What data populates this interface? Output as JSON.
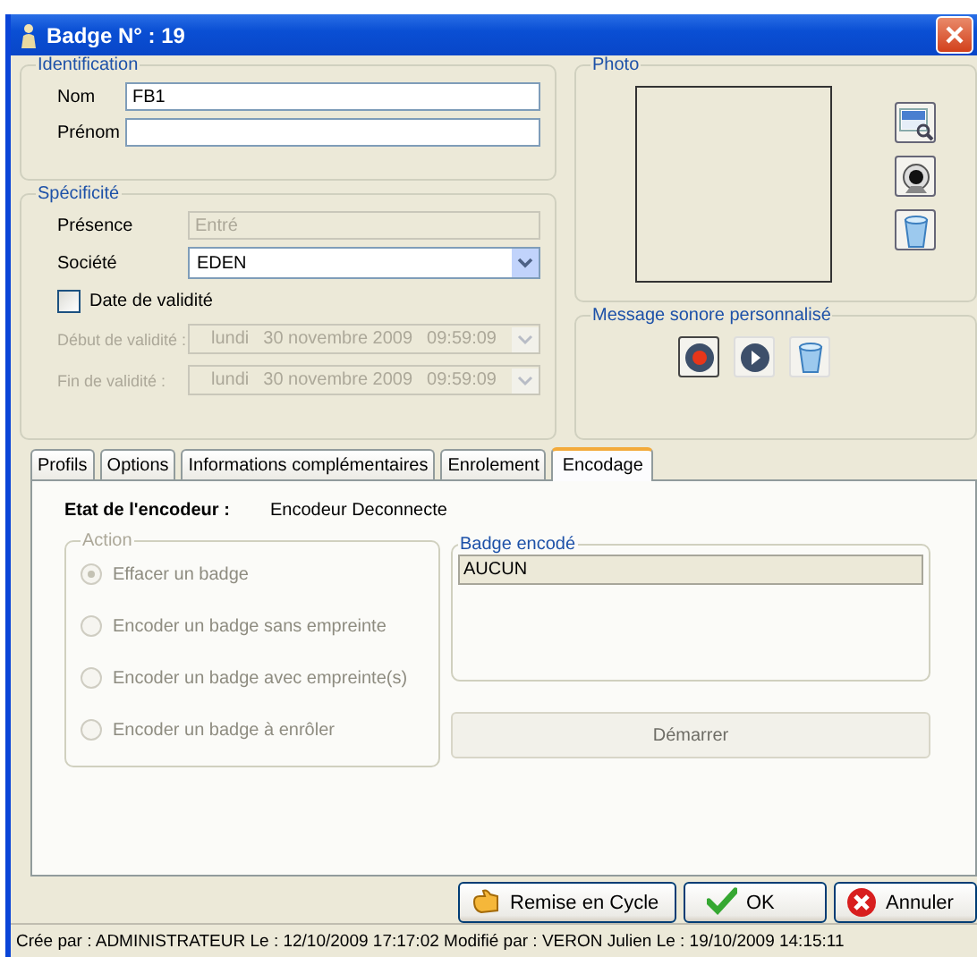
{
  "window": {
    "title": "Badge N° : 19"
  },
  "identification": {
    "title": "Identification",
    "fields": [
      {
        "label": "Nom",
        "value": "FB1"
      },
      {
        "label": "Prénom"
      }
    ]
  },
  "specificite": {
    "title": "Spécificité",
    "presence": {
      "label": "Présence",
      "value": "Entré",
      "disabled": true
    },
    "societe": {
      "label": "Société",
      "value": "EDEN",
      "disabled": false
    },
    "validity_checkbox": {
      "label": "Date de validité",
      "checked": false
    },
    "dates": [
      {
        "label": "Début de validité :",
        "day": "lundi",
        "date": "30 novembre 2009",
        "time": "09:59:09",
        "disabled": true
      },
      {
        "label": "Fin de validité :",
        "day": "lundi",
        "date": "30 novembre 2009",
        "time": "09:59:09",
        "disabled": true
      }
    ]
  },
  "photo": {
    "title": "Photo"
  },
  "sound_message": {
    "title": "Message sonore personnalisé"
  },
  "tabs": [
    {
      "label": "Profils",
      "selected": false
    },
    {
      "label": "Options",
      "selected": false
    },
    {
      "label": "Informations complémentaires",
      "selected": false
    },
    {
      "label": "Enrolement",
      "selected": false
    },
    {
      "label": "Encodage",
      "selected": true
    }
  ],
  "encoder_state": {
    "label": "Etat de l'encodeur :",
    "value": "Encodeur Deconnecte"
  },
  "action": {
    "title": "Action",
    "disabled": true,
    "options": [
      {
        "label": "Effacer un badge",
        "selected": true
      },
      {
        "label": "Encoder un badge sans empreinte",
        "selected": false
      },
      {
        "label": "Encoder un badge avec empreinte(s)",
        "selected": false
      },
      {
        "label": "Encoder un badge à enrôler",
        "selected": false
      }
    ]
  },
  "badge_encoded": {
    "title": "Badge encodé",
    "value": "AUCUN"
  },
  "start_button": {
    "label": "Démarrer",
    "disabled": true
  },
  "buttons": [
    {
      "kind": "cycle",
      "label": "Remise en Cycle"
    },
    {
      "kind": "ok",
      "label": "OK"
    },
    {
      "kind": "cancel",
      "label": "Annuler"
    }
  ],
  "status_bar": "Crée par : ADMINISTRATEUR  Le : 12/10/2009 17:17:02  Modifié par : VERON Julien Le : 19/10/2009 14:15:11"
}
